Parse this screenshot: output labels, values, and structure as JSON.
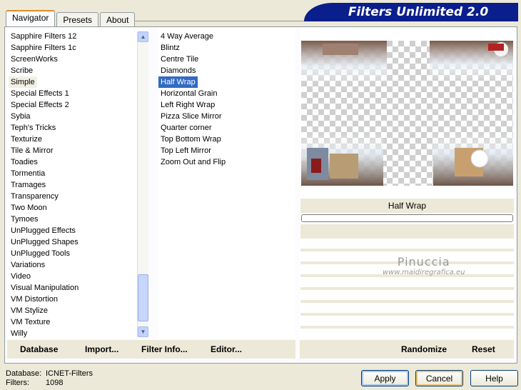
{
  "tabs": [
    "Navigator",
    "Presets",
    "About"
  ],
  "banner": "Filters Unlimited 2.0",
  "categories": [
    "Sapphire Filters 12",
    "Sapphire Filters 1c",
    "ScreenWorks",
    "Scribe",
    "Simple",
    "Special Effects 1",
    "Special Effects 2",
    "Sybia",
    "Teph's Tricks",
    "Texturize",
    "Tile & Mirror",
    "Toadies",
    "Tormentia",
    "Tramages",
    "Transparency",
    "Two Moon",
    "Tymoes",
    "UnPlugged Effects",
    "UnPlugged Shapes",
    "UnPlugged Tools",
    "Variations",
    "Video",
    "Visual Manipulation",
    "VM Distortion",
    "VM Stylize",
    "VM Texture",
    "Willy"
  ],
  "selected_category": "Simple",
  "filters": [
    "4 Way Average",
    "Blintz",
    "Centre Tile",
    "Diamonds",
    "Half Wrap",
    "Horizontal Grain",
    "Left Right Wrap",
    "Pizza Slice Mirror",
    "Quarter corner",
    "Top Bottom Wrap",
    "Top Left Mirror",
    "Zoom Out and Flip"
  ],
  "selected_filter": "Half Wrap",
  "preview_filter_name": "Half Wrap",
  "watermark": {
    "line1": "Pinuccia",
    "line2": "www.maidiregrafica.eu"
  },
  "left_buttons": {
    "database": "Database",
    "import": "Import...",
    "filter_info": "Filter Info...",
    "editor": "Editor..."
  },
  "right_buttons": {
    "randomize": "Randomize",
    "reset": "Reset"
  },
  "status": {
    "database_label": "Database:",
    "database_value": "ICNET-Filters",
    "filters_label": "Filters:",
    "filters_value": "1098"
  },
  "dialog_buttons": {
    "apply": "Apply",
    "cancel": "Cancel",
    "help": "Help"
  },
  "scroll_arrows": {
    "up": "▲",
    "down": "▼"
  }
}
